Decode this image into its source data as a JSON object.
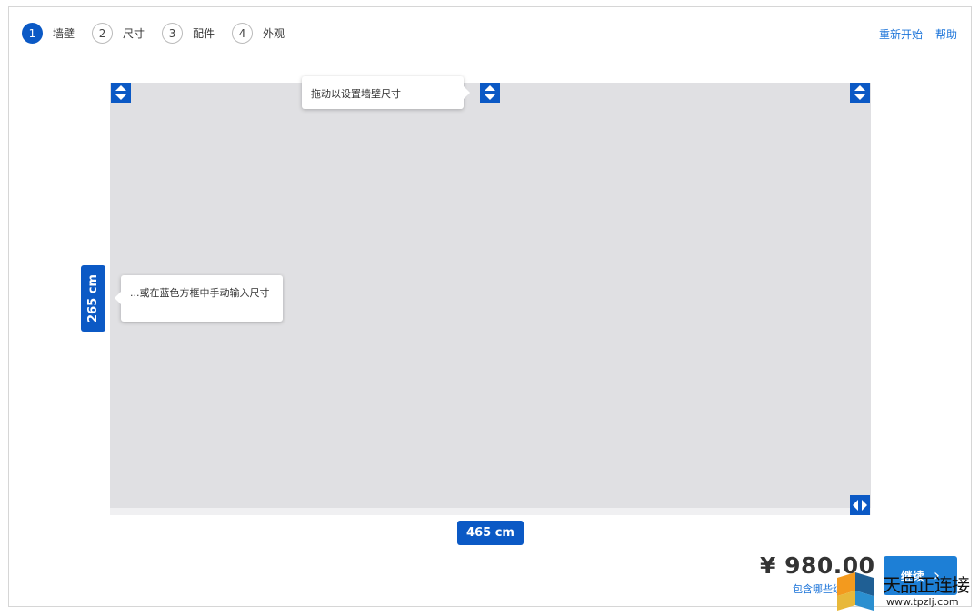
{
  "steps": [
    {
      "num": "1",
      "label": "墙壁",
      "active": true
    },
    {
      "num": "2",
      "label": "尺寸",
      "active": false
    },
    {
      "num": "3",
      "label": "配件",
      "active": false
    },
    {
      "num": "4",
      "label": "外观",
      "active": false
    }
  ],
  "top_links": {
    "restart": "重新开始",
    "help": "帮助"
  },
  "canvas": {
    "tooltip_drag": "拖动以设置墙壁尺寸",
    "tooltip_input": "...或在蓝色方框中手动输入尺寸",
    "height_value": "265 cm",
    "width_value": "465 cm"
  },
  "footer": {
    "price": "¥ 980.00",
    "price_detail_link": "包含哪些组",
    "continue_label": "继续"
  },
  "watermark": {
    "text": "天品正连接",
    "url": "www.tpzlj.com"
  },
  "colors": {
    "accent": "#0b59c5",
    "canvas": "#e0e0e3",
    "link": "#1a73d9",
    "button": "#1d7fd6"
  },
  "icons": {
    "vertical_handle": "arrow-up-down-icon",
    "horizontal_handle": "arrow-left-right-icon",
    "continue_chevron": "chevron-right-icon"
  }
}
